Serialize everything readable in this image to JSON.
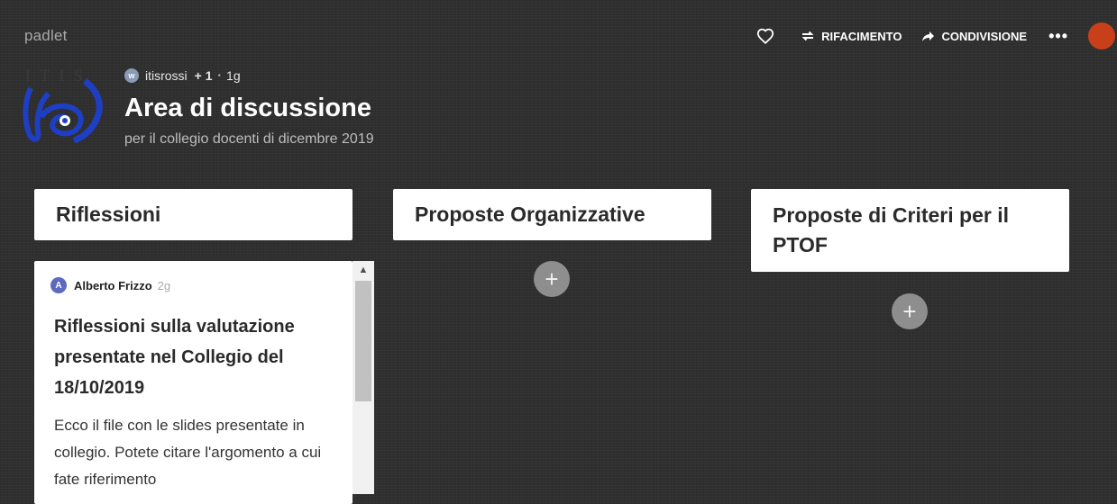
{
  "app": {
    "brand": "padlet"
  },
  "topbar": {
    "like_icon": "heart-icon",
    "remake_icon": "repeat-icon",
    "remake_label": "RIFACIMENTO",
    "share_icon": "share-arrow-icon",
    "share_label": "CONDIVISIONE",
    "more_label": "•••",
    "user_avatar_color": "#c8401a"
  },
  "header": {
    "logo_text": "I T I S",
    "owner_initial": "w",
    "owner": "itisrossi",
    "contributors": "+ 1",
    "separator": "•",
    "age": "1g",
    "title": "Area di discussione",
    "subtitle": "per il collegio docenti di dicembre 2019"
  },
  "columns": [
    {
      "title": "Riflessioni"
    },
    {
      "title": "Proposte Organizzative",
      "add_label": "+"
    },
    {
      "title": "Proposte di Criteri per il PTOF",
      "add_label": "+"
    }
  ],
  "post": {
    "author_initial": "A",
    "author": "Alberto Frizzo",
    "time": "2g",
    "title": "Riflessioni sulla valutazione presentate nel Collegio del 18/10/2019",
    "body": "Ecco il file con le slides presentate in collegio. Potete citare l'argomento a cui fate riferimento"
  },
  "scrollbar": {
    "up_arrow": "▲"
  },
  "colors": {
    "background": "#2f2f2f",
    "column_header": "#ffffff",
    "add_button": "#8e8e8e",
    "post_avatar": "#5c6bc0"
  }
}
